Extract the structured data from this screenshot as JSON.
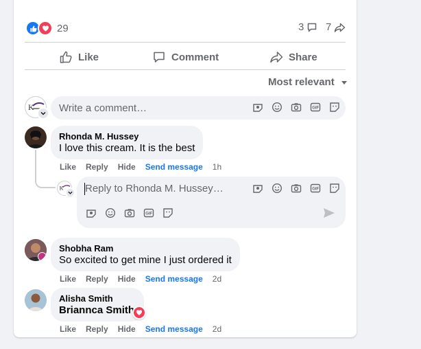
{
  "reactions": {
    "count": "29"
  },
  "stats": {
    "comments": "3",
    "shares": "7"
  },
  "actions": {
    "like": "Like",
    "comment": "Comment",
    "share": "Share"
  },
  "sort": {
    "label": "Most relevant"
  },
  "composer": {
    "placeholder": "Write a comment…"
  },
  "comments": [
    {
      "author": "Rhonda M. Hussey",
      "text": "I love this cream. It is the best",
      "like": "Like",
      "reply": "Reply",
      "hide": "Hide",
      "send": "Send message",
      "time": "1h"
    },
    {
      "author": "Shobha Ram",
      "text": "So excited to get mine I just ordered it",
      "like": "Like",
      "reply": "Reply",
      "hide": "Hide",
      "send": "Send message",
      "time": "2d"
    },
    {
      "author": "Alisha Smith",
      "text": "Briannca Smith",
      "like": "Like",
      "reply": "Reply",
      "hide": "Hide",
      "send": "Send message",
      "time": "2d"
    }
  ],
  "reply_composer": {
    "placeholder": "Reply to Rhonda M. Hussey…"
  },
  "colors": {
    "accent": "#1877f2",
    "love": "#f33e58",
    "muted": "#65676b"
  }
}
